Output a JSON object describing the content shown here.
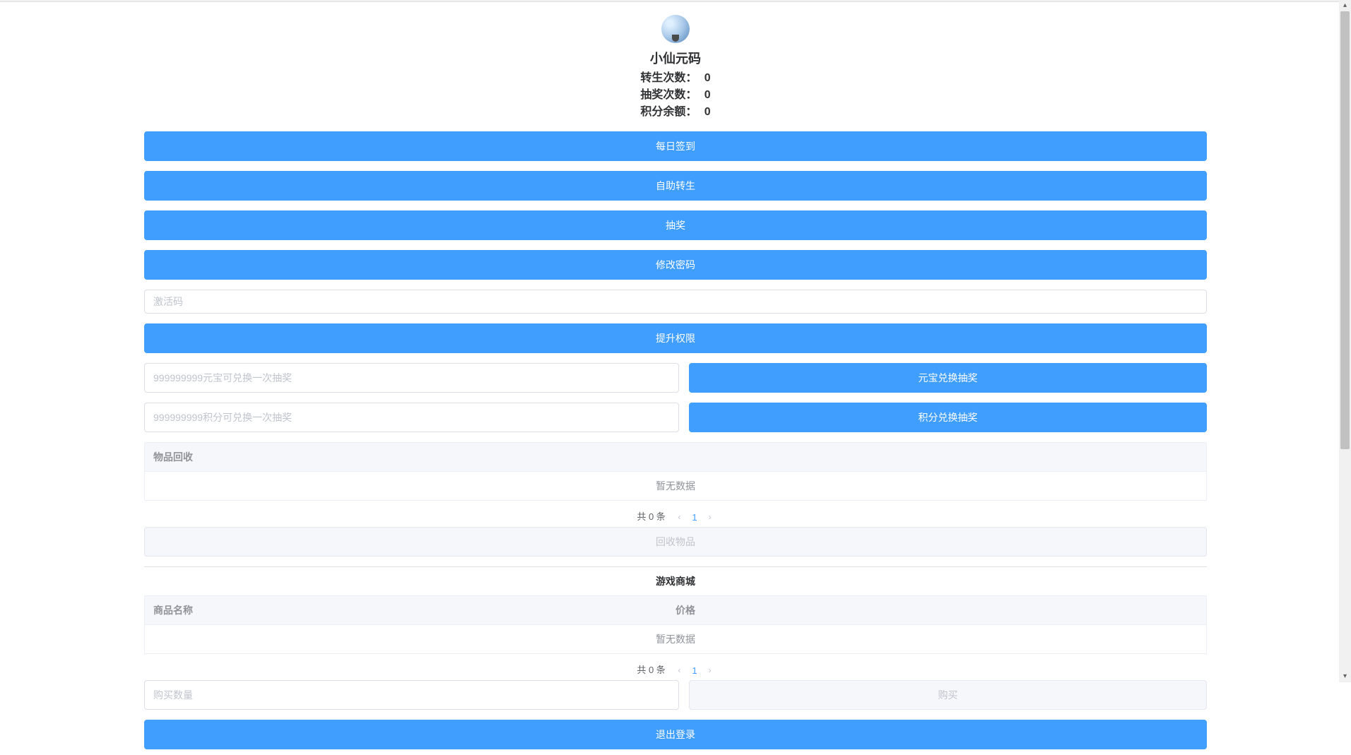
{
  "header": {
    "username": "小仙元码",
    "stats": [
      {
        "label": "转生次数：",
        "value": "0"
      },
      {
        "label": "抽奖次数：",
        "value": "0"
      },
      {
        "label": "积分余额：",
        "value": "0"
      }
    ]
  },
  "buttons": {
    "daily_signin": "每日签到",
    "self_rebirth": "自助转生",
    "lottery": "抽奖",
    "change_password": "修改密码",
    "upgrade_permission": "提升权限",
    "yuanbao_exchange": "元宝兑换抽奖",
    "points_exchange": "积分兑换抽奖",
    "recycle_item": "回收物品",
    "purchase": "购买",
    "logout": "退出登录"
  },
  "inputs": {
    "activation_code_placeholder": "激活码",
    "yuanbao_placeholder": "999999999元宝可兑换一次抽奖",
    "points_placeholder": "999999999积分可兑换一次抽奖",
    "purchase_qty_placeholder": "购买数量"
  },
  "recycle_table": {
    "header": "物品回收",
    "empty_text": "暂无数据",
    "total_text": "共 0 条",
    "current_page": "1"
  },
  "mall": {
    "title": "游戏商城",
    "col_name": "商品名称",
    "col_price": "价格",
    "empty_text": "暂无数据",
    "total_text": "共 0 条",
    "current_page": "1"
  }
}
